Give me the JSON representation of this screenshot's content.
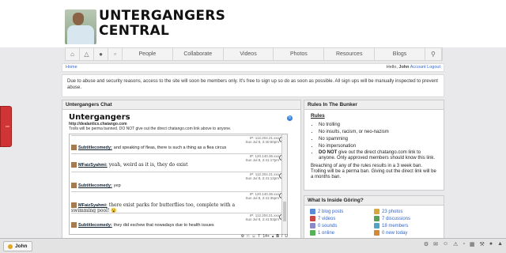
{
  "site": {
    "title_line1": "UNTERGANGERS",
    "title_line2": "CENTRAL"
  },
  "nav": {
    "icons": [
      "home-icon",
      "car-icon",
      "user-icon",
      "chat-icon"
    ],
    "tabs": [
      "People",
      "Collaborate",
      "Videos",
      "Photos",
      "Resources",
      "Blogs"
    ],
    "search_icon": "search-icon"
  },
  "breadcrumb": {
    "home": "Home"
  },
  "userbar": {
    "hello_prefix": "Hello, ",
    "username": "John",
    "account": "Account",
    "logout": "Logout"
  },
  "notice": "Due to abuse and security reasons, access to the site will soon be members only. It's free to sign up so do as soon as possible. All sign ups will be manually inspected to prevent abuse.",
  "chat": {
    "panel_title": "Untergangers Chat",
    "title": "Untergangers",
    "url": "http://dealantics.chatango.com",
    "note": "Trolls will be perma banned. DO NOT give out the direct chatango.com link above to anyone.",
    "messages": [
      {
        "ip": "IP: 112.204.21.xxx",
        "time": "Sun Jul 8, 2:40:50pm",
        "user": "Subtitlecomedy:",
        "text": "and speaking of fleas, there is such a thing as a flea circus",
        "serif": false
      },
      {
        "ip": "IP: 120.140.36.xxx",
        "time": "Sun Jul 8, 2:41:17pm",
        "user": "MFaizSyahmi:",
        "text": "yeah, weird as it is, they do exist",
        "serif": true
      },
      {
        "ip": "IP: 112.204.21.xxx",
        "time": "Sun Jul 8, 2:41:12pm",
        "user": "Subtitlecomedy:",
        "text": "yep",
        "serif": false
      },
      {
        "ip": "IP: 120.140.36.xxx",
        "time": "Sun Jul 8, 2:41:35pm",
        "user": "MFaizSyahmi:",
        "text": "there exist parks for butterflies too, complete with a swimming pool! 😮",
        "serif": true
      },
      {
        "ip": "IP: 112.204.21.xxx",
        "time": "Sun Jul 8, 2:41:53pm",
        "user": "Subtitlecomedy:",
        "text": "they did eschew that nowadays due to health issues",
        "serif": false
      }
    ],
    "toolbar": [
      "⚙",
      "□",
      "☺",
      "T",
      "14+",
      "▴",
      "B",
      "I",
      "U"
    ]
  },
  "rules": {
    "panel_title": "Rules In The Bunker",
    "heading": "Rules",
    "items": [
      "No trolling",
      "No insults, racism, or neo-nazism",
      "No spamming",
      "No impersonation"
    ],
    "item_bold": "DO NOT",
    "item_rest": " give out the direct chatango.com link to anyone. Only approved members should know this link.",
    "footer": "Breaching of any of the rules results in a 3 week ban. Trolling will be a perma ban. Giving out the direct link will be a months ban."
  },
  "inside": {
    "panel_title": "What Is Inside Göring?",
    "stats": [
      {
        "label": "2 blog posts",
        "color": "#5a8bd6"
      },
      {
        "label": "23 photos",
        "color": "#d8a93a"
      },
      {
        "label": "7 videos",
        "color": "#c84848"
      },
      {
        "label": "7 discussions",
        "color": "#5aa05a"
      },
      {
        "label": "0 sounds",
        "color": "#8a8acb"
      },
      {
        "label": "18 members",
        "color": "#4ea3c6"
      },
      {
        "label": "1 online",
        "color": "#58b058"
      },
      {
        "label": "0 new today",
        "color": "#d08a3a"
      }
    ]
  },
  "sidetab": {
    "label": "I"
  },
  "bottombar": {
    "user": "John"
  }
}
